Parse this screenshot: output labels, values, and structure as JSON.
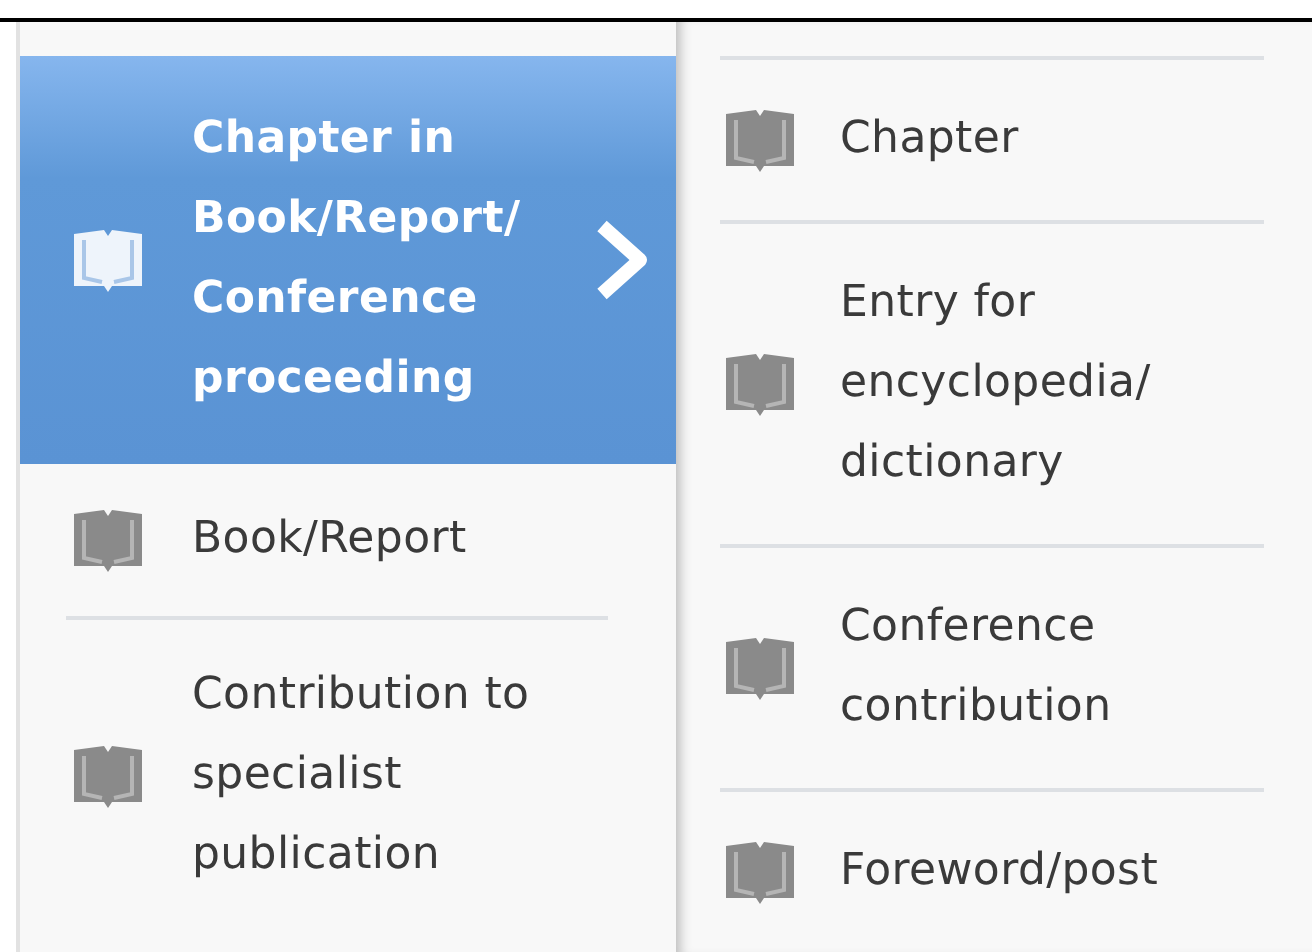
{
  "menu": {
    "items": [
      {
        "label": "Chapter in Book/Report/ Conference proceeding",
        "selected": true,
        "has_submenu": true
      },
      {
        "label": "Book/Report",
        "selected": false,
        "has_submenu": false
      },
      {
        "label": "Contribution to specialist publication",
        "selected": false,
        "has_submenu": false
      }
    ]
  },
  "submenu": {
    "items": [
      {
        "label": "Chapter"
      },
      {
        "label": "Entry for encyclopedia/ dictionary"
      },
      {
        "label": "Conference contribution"
      },
      {
        "label": "Foreword/post"
      }
    ]
  }
}
